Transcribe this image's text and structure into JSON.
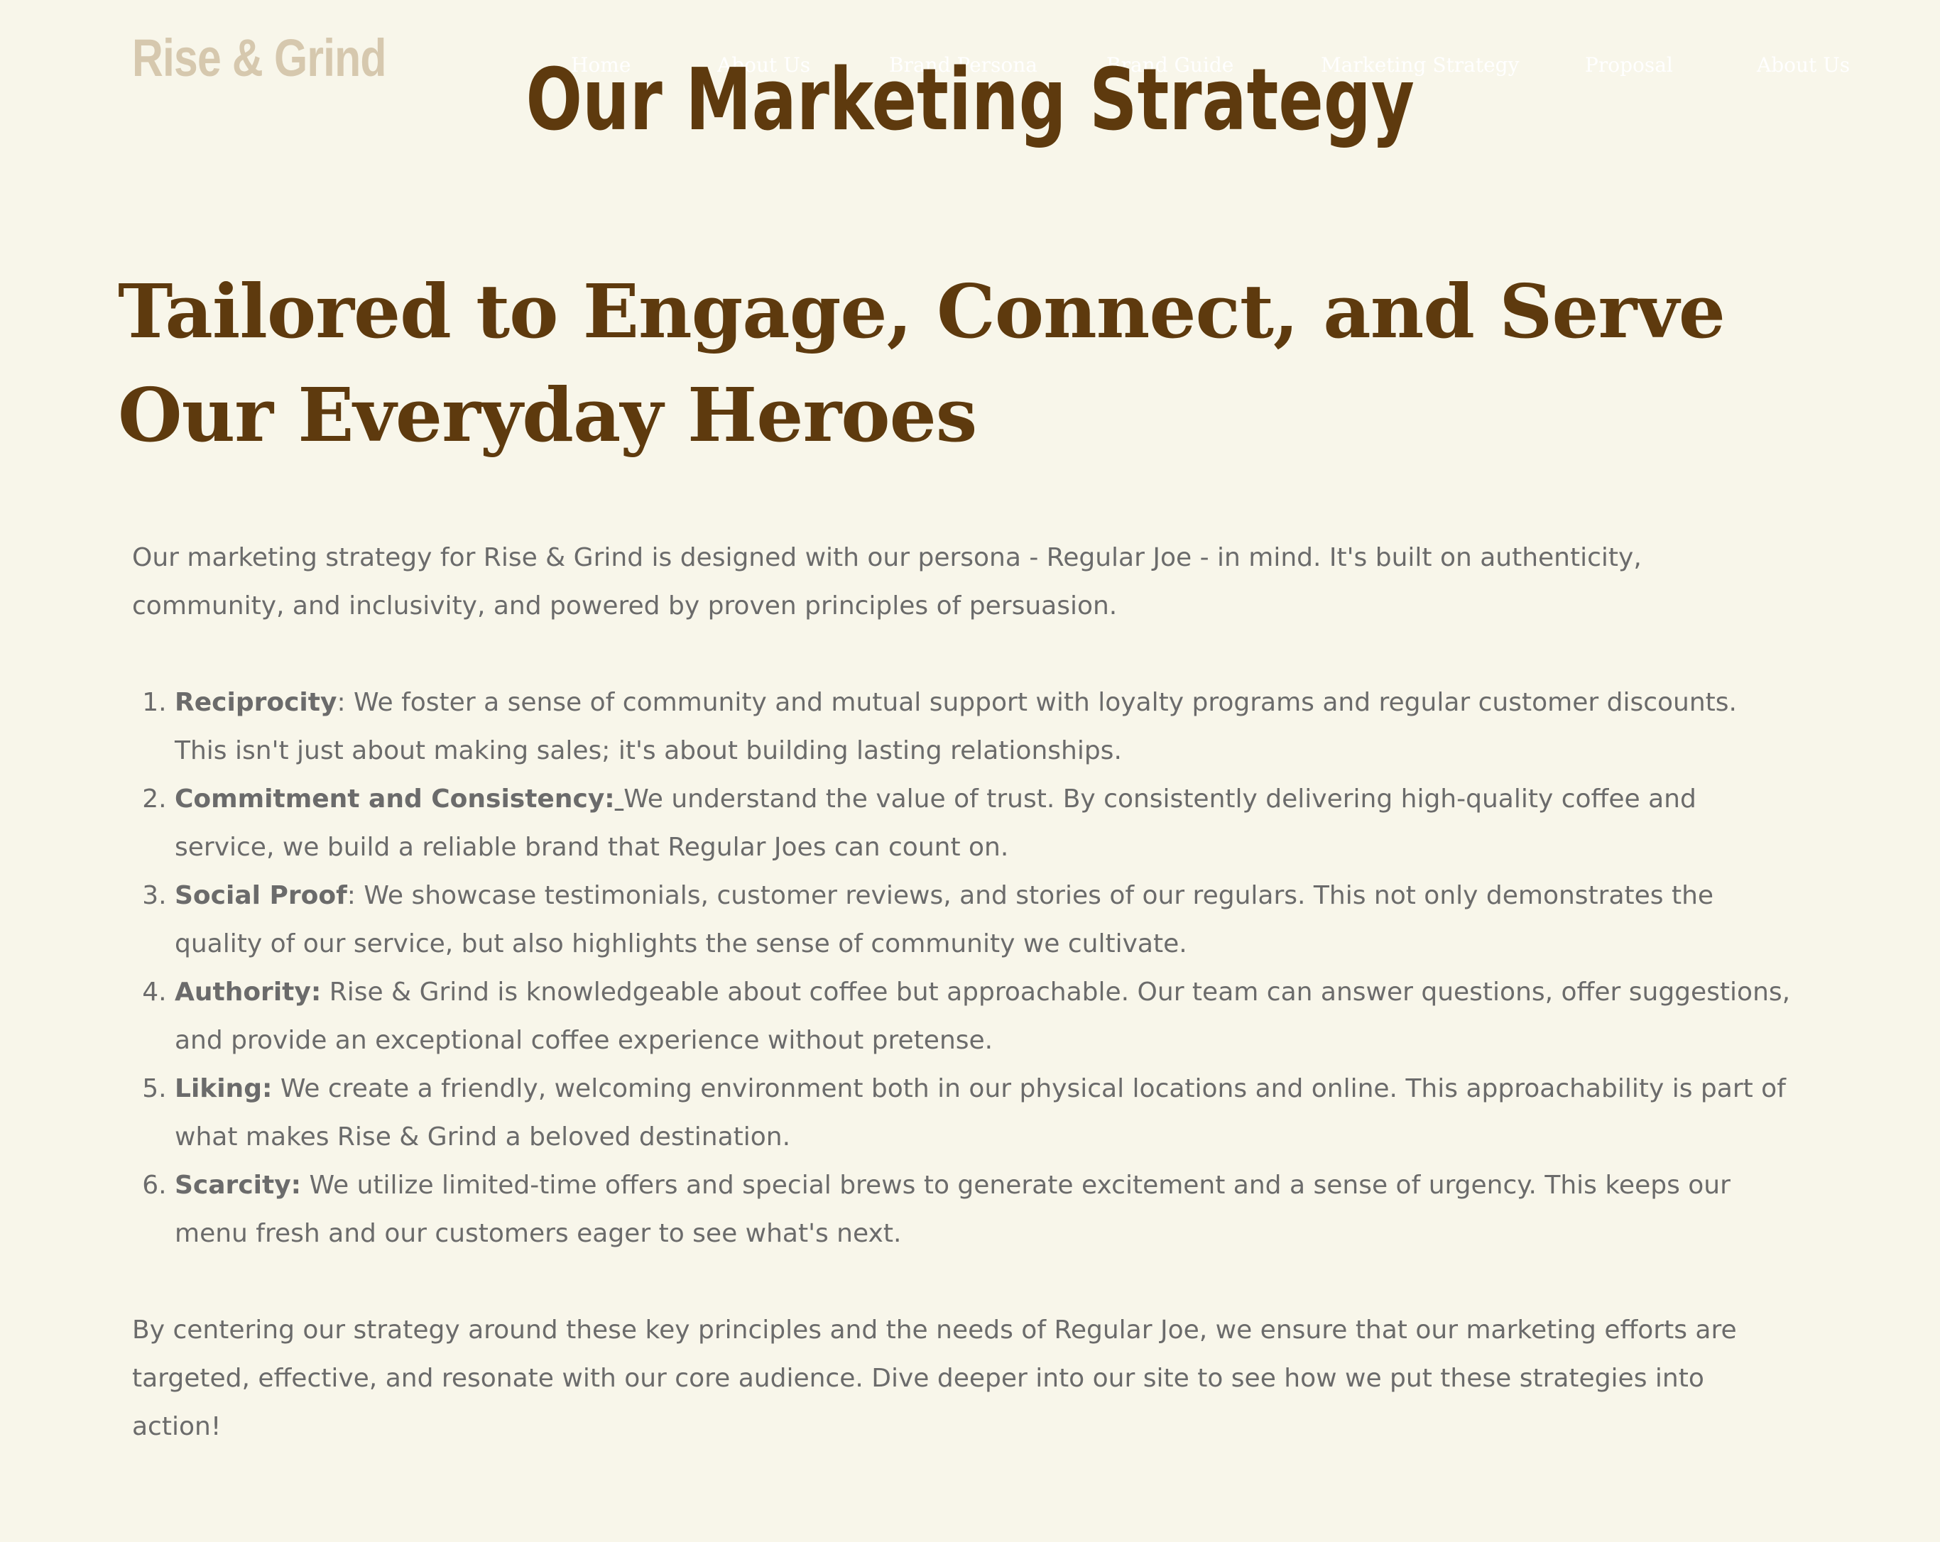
{
  "header": {
    "logo": "Rise & Grind",
    "nav": [
      {
        "label": "Home"
      },
      {
        "label": "About Us"
      },
      {
        "label": "Brand Persona"
      },
      {
        "label": "Brand Guide"
      },
      {
        "label": "Marketing Strategy"
      },
      {
        "label": "Proposal"
      },
      {
        "label": "About Us"
      }
    ]
  },
  "page": {
    "title": "Our Marketing Strategy",
    "tagline": "Tailored to Engage, Connect, and Serve Our Everyday Heroes",
    "intro": "Our marketing strategy for Rise & Grind is designed with our persona - Regular Joe - in mind. It's built on authenticity, community, and inclusivity, and powered by proven principles of persuasion.",
    "principles": [
      {
        "term": "Reciprocity",
        "sep": ":",
        "text": " We foster a sense of community and mutual support with loyalty programs and regular customer discounts. This isn't just about making sales; it's about building lasting relationships."
      },
      {
        "term": "Commitment and Consistency:",
        "sep": " ",
        "text": "We understand the value of trust. By consistently delivering high-quality coffee and service, we build a reliable brand that Regular Joes can count on."
      },
      {
        "term": "Social Proof",
        "sep": ":",
        "text": " We showcase testimonials, customer reviews, and stories of our regulars. This not only demonstrates the quality of our service, but also highlights the sense of community we cultivate."
      },
      {
        "term": "Authority:",
        "sep": " ",
        "text": "Rise & Grind is knowledgeable about coffee but approachable. Our team can answer questions, offer suggestions, and provide an exceptional coffee experience without pretense."
      },
      {
        "term": "Liking:",
        "sep": " ",
        "text": "We create a friendly, welcoming environment both in our physical locations and online. This approachability is part of what makes Rise & Grind a beloved destination."
      },
      {
        "term": "Scarcity:",
        "sep": " ",
        "text": "We utilize limited-time offers and special brews to generate excitement and a sense of urgency. This keeps our menu fresh and our customers eager to see what's next."
      }
    ],
    "closing": "By centering our strategy around these key principles and the needs of Regular Joe, we ensure that our marketing efforts are targeted, effective, and resonate with our core audience. Dive deeper into our site to see how we put these strategies into action!"
  },
  "colors": {
    "background": "#f8f6ea",
    "heading": "#5e3a0e",
    "body_text": "#6b6b6b",
    "logo": "#d6c8ae",
    "nav_text": "#ffffff"
  }
}
